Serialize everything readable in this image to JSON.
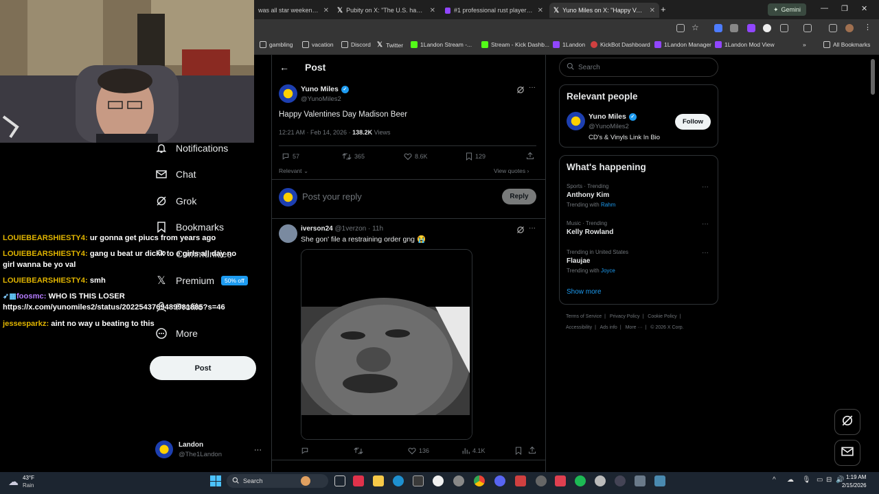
{
  "browser": {
    "tabs": [
      {
        "title": "was all star weekend 20..."
      },
      {
        "title": "Pubity on X: \"The U.S. has disc..."
      },
      {
        "title": "#1 professional rust player + m..."
      },
      {
        "title": "Yuno Miles on X: \"Happy Valen..."
      }
    ],
    "gemini_label": "Gemini",
    "bookmarks": [
      "gambling",
      "vacation",
      "Discord",
      "Twitter",
      "1Landon Stream -...",
      "Stream - Kick Dashb...",
      "1Landon",
      "KickBot Dashboard",
      "1Landon Manager",
      "1Landon Mod View"
    ],
    "all_bookmarks": "All Bookmarks"
  },
  "nav": {
    "items": [
      {
        "label": "Notifications",
        "icon": "bell-icon"
      },
      {
        "label": "Chat",
        "icon": "mail-icon"
      },
      {
        "label": "Grok",
        "icon": "grok-icon"
      },
      {
        "label": "Bookmarks",
        "icon": "bookmark-icon"
      },
      {
        "label": "Communities",
        "icon": "communities-icon"
      },
      {
        "label": "Premium",
        "icon": "x-icon"
      },
      {
        "label": "Profile",
        "icon": "profile-icon"
      },
      {
        "label": "More",
        "icon": "more-icon"
      }
    ],
    "premium_badge": "50% off",
    "post_button": "Post",
    "account": {
      "name": "Landon",
      "handle": "@The1Landon"
    }
  },
  "chat": [
    {
      "user": "LOUIEBEARSHIESTY4:",
      "msg": "ur gonna get piucs from years ago"
    },
    {
      "user": "LOUIEBEARSHIESTY4:",
      "msg": "gang u beat ur dickk to e girls all day no girl wanna be yo val"
    },
    {
      "user": "LOUIEBEARSHIESTY4:",
      "msg": "smh"
    },
    {
      "user": "foosmc:",
      "msg": "WHO IS THIS LOSER https://x.com/yunomiles2/status/2022543769489981885?s=46"
    },
    {
      "user": "jessesparkz:",
      "msg": "aint no way u beating to this"
    }
  ],
  "post": {
    "header": "Post",
    "author_name": "Yuno Miles",
    "author_handle": "@YunoMiles2",
    "text": "Happy Valentines Day Madison Beer",
    "time": "12:21 AM · Feb 14, 2026 · ",
    "views_count": "138.2K",
    "views_label": " Views",
    "replies": "57",
    "reposts": "365",
    "likes": "8.6K",
    "bookmarks": "129",
    "relevant": "Relevant",
    "view_quotes": "View quotes",
    "reply_placeholder": "Post your reply",
    "reply_button": "Reply"
  },
  "reply": {
    "author_name": "iverson24",
    "author_meta": "@1verzon · 11h",
    "text": "She gon' file a restraining order gng 😭",
    "likes": "136",
    "views": "4.1K"
  },
  "sidebar": {
    "search_placeholder": "Search",
    "relevant_people_title": "Relevant people",
    "person": {
      "name": "Yuno Miles",
      "handle": "@YunoMiles2",
      "bio": "CD's & Vinyls Link In Bio",
      "follow": "Follow"
    },
    "whats_happening_title": "What's happening",
    "trends": [
      {
        "category": "Sports · Trending",
        "name": "Anthony Kim",
        "with_label": "Trending with ",
        "with": "Rahm"
      },
      {
        "category": "Music · Trending",
        "name": "Kelly Rowland",
        "with_label": "",
        "with": ""
      },
      {
        "category": "Trending in United States",
        "name": "Flaujae",
        "with_label": "Trending with ",
        "with": "Joyce"
      }
    ],
    "show_more": "Show more",
    "footer_line1": [
      "Terms of Service",
      "Privacy Policy",
      "Cookie Policy"
    ],
    "footer_line2": [
      "Accessibility",
      "Ads info",
      "More ···",
      "© 2026 X Corp."
    ]
  },
  "taskbar": {
    "weather_temp": "43°F",
    "weather_desc": "Rain",
    "search_label": "Search",
    "time": "1:19 AM",
    "date": "2/15/2026"
  }
}
